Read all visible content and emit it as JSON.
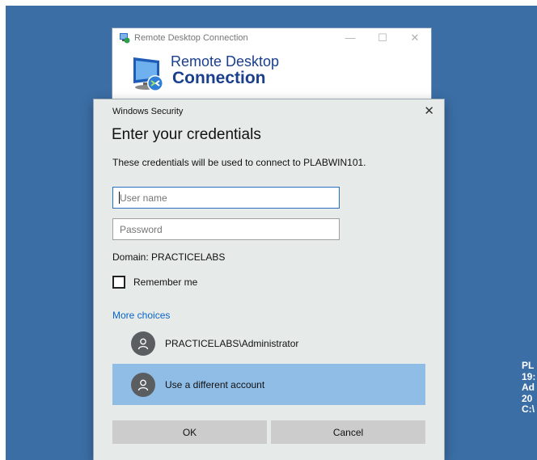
{
  "rdc_window": {
    "title": "Remote Desktop Connection",
    "banner_line1": "Remote Desktop",
    "banner_line2": "Connection",
    "controls": {
      "minimize": "—",
      "maximize": "☐",
      "close": "✕"
    }
  },
  "security_dialog": {
    "title": "Windows Security",
    "close": "✕",
    "heading": "Enter your credentials",
    "description": "These credentials will be used to connect to PLABWIN101.",
    "username_placeholder": "User name",
    "password_placeholder": "Password",
    "domain": "Domain: PRACTICELABS",
    "remember_label": "Remember me",
    "more_choices": "More choices",
    "accounts": [
      {
        "label": "PRACTICELABS\\Administrator",
        "selected": false
      },
      {
        "label": "Use a different account",
        "selected": true
      }
    ],
    "ok_label": "OK",
    "cancel_label": "Cancel"
  },
  "desktop_info": [
    "PL",
    "19:",
    "Ad",
    "20",
    "C:\\"
  ],
  "colors": {
    "desktop": "#3b6ea5",
    "dialog_bg": "#e6ebea",
    "selected_account": "#90bde6",
    "link": "#0a64c4",
    "brand_text": "#1a3f8c"
  }
}
